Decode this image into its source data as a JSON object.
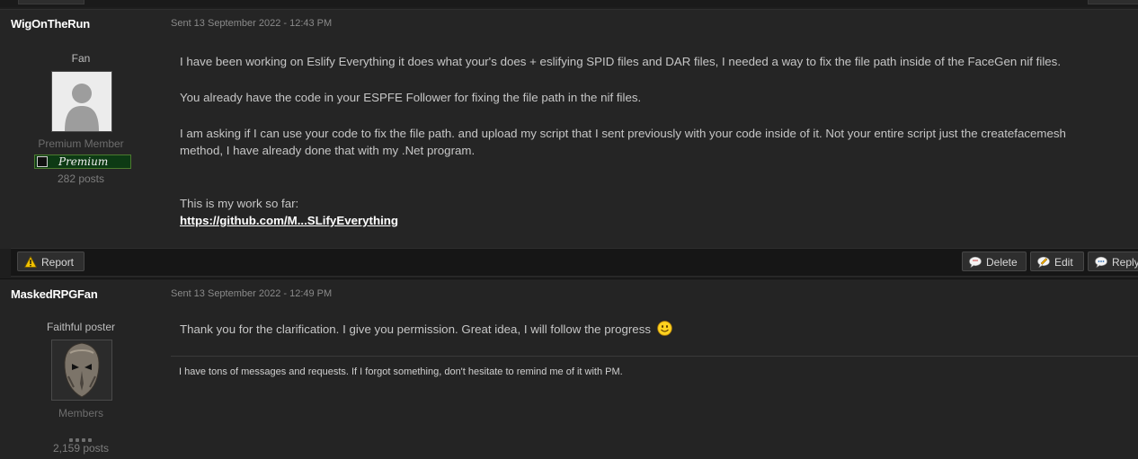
{
  "post1": {
    "author": "WigOnTheRun",
    "sent": "Sent 13 September 2022 - 12:43 PM",
    "rank": "Fan",
    "group": "Premium Member",
    "badge_text": "Premium",
    "post_count": "282 posts",
    "paragraphs": [
      "I have been working on Eslify Everything it does what your's does + eslifying SPID files and DAR files, I needed a way to fix the file path inside of the FaceGen nif files.",
      "You already have the code in your ESPFE Follower for fixing the file path in the nif files.",
      "I am asking if I can use your code to fix the file path. and upload my script that I sent previously with your code inside of it. Not your entire script just the createfacemesh method, I have already done that with my .Net program.",
      "This is my work so far:"
    ],
    "link_text": "https://github.com/M...SLifyEverything",
    "actions": {
      "report": "Report",
      "delete": "Delete",
      "edit": "Edit",
      "reply": "Reply"
    }
  },
  "post2": {
    "author": "MaskedRPGFan",
    "sent": "Sent 13 September 2022 - 12:49 PM",
    "rank": "Faithful poster",
    "group": "Members",
    "post_count": "2,159 posts",
    "message": "Thank you for the clarification. I give you permission. Great idea, I will follow the progress",
    "signature": "I have tons of messages and requests. If I forgot something, don't hesitate to remind me of it with PM."
  },
  "icons": {
    "warning": "warning-icon",
    "delete": "speech-bubble-icon",
    "edit": "pencil-bubble-icon",
    "reply": "reply-bubble-icon",
    "smiley": "smiley-icon"
  }
}
